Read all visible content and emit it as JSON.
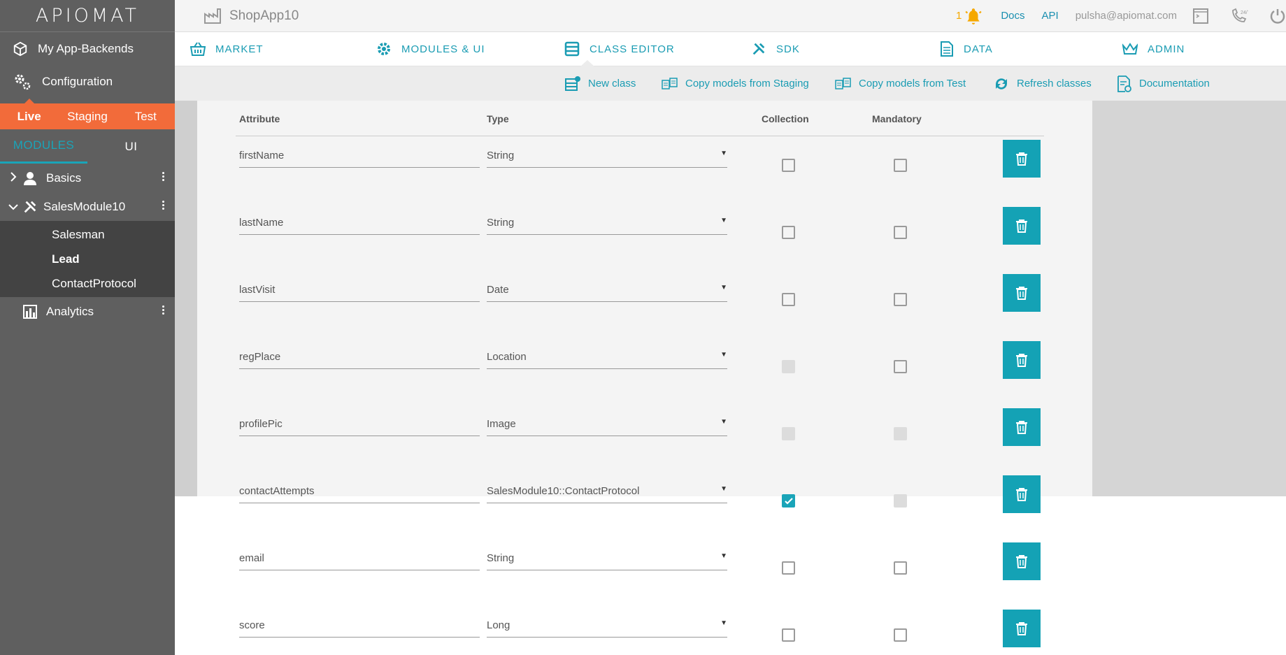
{
  "logo": {
    "text": "APIOMAT"
  },
  "sidebar": {
    "items": [
      {
        "label": "My App-Backends",
        "icon": "cube-icon"
      },
      {
        "label": "Configuration",
        "icon": "gears-icon"
      }
    ],
    "environments": [
      {
        "label": "Live",
        "active": true
      },
      {
        "label": "Staging",
        "active": false
      },
      {
        "label": "Test",
        "active": false
      }
    ],
    "module_tabs": [
      {
        "label": "MODULES",
        "active": true
      },
      {
        "label": "UI",
        "active": false
      }
    ],
    "modules": [
      {
        "label": "Basics",
        "icon": "person-icon",
        "expanded": false
      },
      {
        "label": "SalesModule10",
        "icon": "tools-icon",
        "expanded": true,
        "classes": [
          {
            "label": "Salesman",
            "active": false
          },
          {
            "label": "Lead",
            "active": true
          },
          {
            "label": "ContactProtocol",
            "active": false
          }
        ]
      },
      {
        "label": "Analytics",
        "icon": "chart-icon",
        "expanded": false
      }
    ]
  },
  "topbar": {
    "app_name": "ShopApp10",
    "notification_count": "1",
    "docs_label": "Docs",
    "api_label": "API",
    "user_email": "pulsha@apiomat.com"
  },
  "mainnav": [
    {
      "label": "MARKET",
      "icon": "basket-icon"
    },
    {
      "label": "MODULES & UI",
      "icon": "gear-icon"
    },
    {
      "label": "CLASS EDITOR",
      "icon": "class-editor-icon",
      "active": true
    },
    {
      "label": "SDK",
      "icon": "tools-icon"
    },
    {
      "label": "DATA",
      "icon": "document-icon"
    },
    {
      "label": "ADMIN",
      "icon": "crown-icon"
    }
  ],
  "toolbar": {
    "new_class": "New class",
    "copy_staging": "Copy models from Staging",
    "copy_test": "Copy models from Test",
    "refresh": "Refresh classes",
    "documentation": "Documentation"
  },
  "table": {
    "headers": {
      "attribute": "Attribute",
      "type": "Type",
      "collection": "Collection",
      "mandatory": "Mandatory"
    },
    "rows": [
      {
        "name": "firstName",
        "type": "String",
        "collection": "unchecked",
        "mandatory": "unchecked"
      },
      {
        "name": "lastName",
        "type": "String",
        "collection": "unchecked",
        "mandatory": "unchecked"
      },
      {
        "name": "lastVisit",
        "type": "Date",
        "collection": "unchecked",
        "mandatory": "unchecked"
      },
      {
        "name": "regPlace",
        "type": "Location",
        "collection": "disabled",
        "mandatory": "unchecked"
      },
      {
        "name": "profilePic",
        "type": "Image",
        "collection": "disabled",
        "mandatory": "disabled"
      },
      {
        "name": "contactAttempts",
        "type": "SalesModule10::ContactProtocol",
        "collection": "checked",
        "mandatory": "disabled"
      },
      {
        "name": "email",
        "type": "String",
        "collection": "unchecked",
        "mandatory": "unchecked"
      },
      {
        "name": "score",
        "type": "Long",
        "collection": "unchecked",
        "mandatory": "unchecked"
      }
    ]
  },
  "colors": {
    "accent": "#14a2b5",
    "env_bar": "#f26b3a",
    "sidebar": "#5f5f5f",
    "notification": "#f5a800"
  }
}
